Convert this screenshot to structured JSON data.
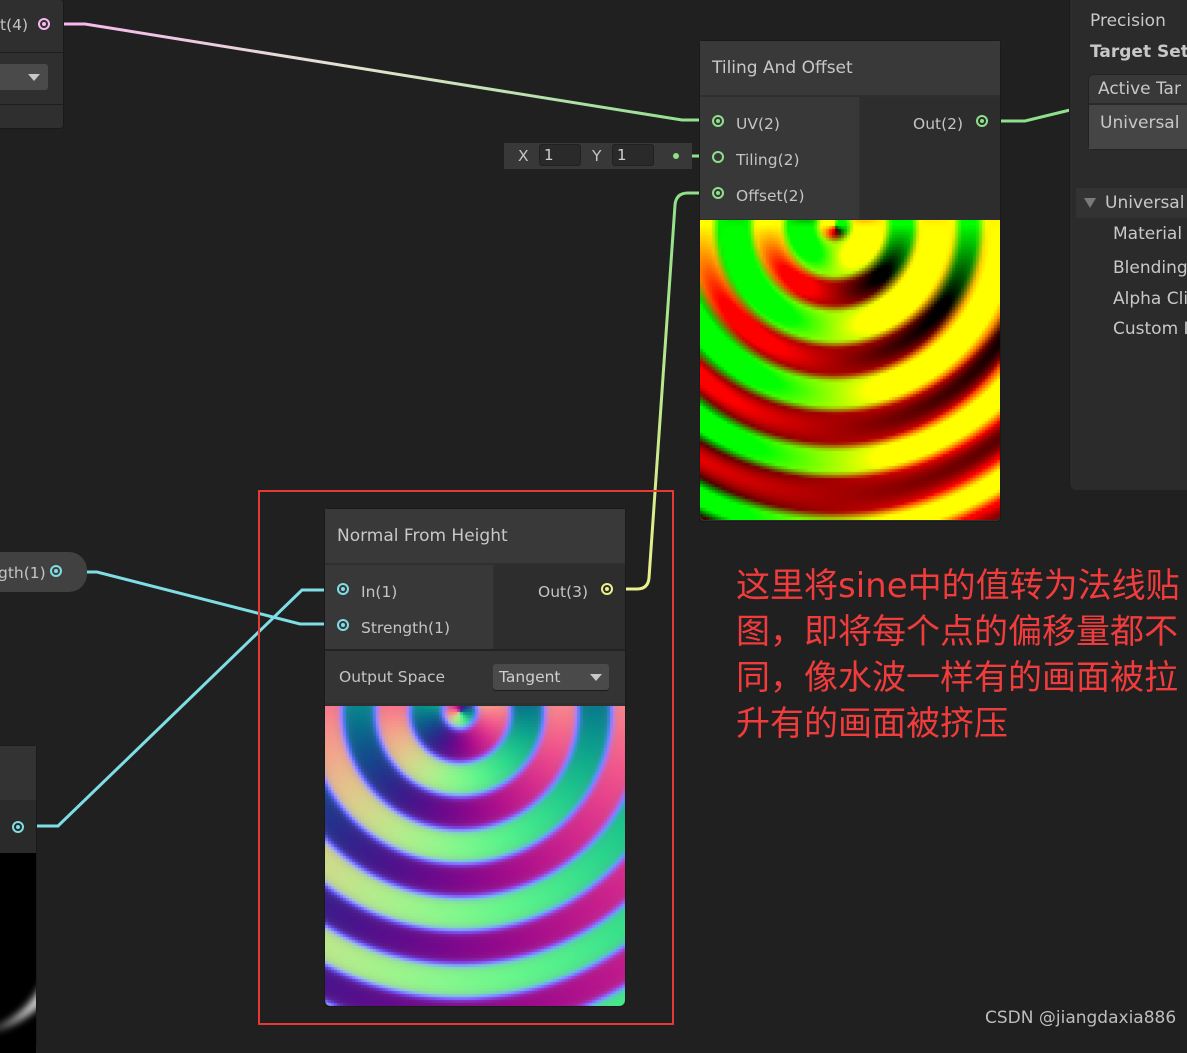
{
  "left_node_top": {
    "output_label": "t(4)"
  },
  "left_property_node": {
    "output_label": "gth(1)"
  },
  "tiling_offset_node": {
    "title": "Tiling And Offset",
    "inputs": [
      {
        "label": "UV(2)"
      },
      {
        "label": "Tiling(2)"
      },
      {
        "label": "Offset(2)"
      }
    ],
    "outputs": [
      {
        "label": "Out(2)"
      }
    ],
    "tiling_inline": {
      "x_label": "X",
      "x_value": "1",
      "y_label": "Y",
      "y_value": "1"
    }
  },
  "normal_from_height_node": {
    "title": "Normal From Height",
    "inputs": [
      {
        "label": "In(1)"
      },
      {
        "label": "Strength(1)"
      }
    ],
    "outputs": [
      {
        "label": "Out(3)"
      }
    ],
    "output_space_label": "Output Space",
    "output_space_value": "Tangent"
  },
  "inspector": {
    "precision_label": "Precision",
    "target_settings_label": "Target Sett",
    "active_targets_label": "Active Tar",
    "active_target_item": "Universal",
    "foldout_label": "Universal",
    "items": [
      "Material",
      "Blending",
      "Alpha Cli",
      "Custom I"
    ]
  },
  "annotation": {
    "text": "这里将sine中的值转为法线贴图，即将每个点的偏移量都不同，像水波一样有的画面被拉升有的画面被挤压",
    "color": "#f03c3c"
  },
  "watermark": "CSDN @jiangdaxia886",
  "colors": {
    "background": "#202020",
    "vector2_wire": "#8ee08a",
    "vector1_wire": "#7fdde6",
    "vector3_wire": "#ecf18c",
    "vector4_wire": "#f6b7ef",
    "highlight_box": "#e53935"
  }
}
